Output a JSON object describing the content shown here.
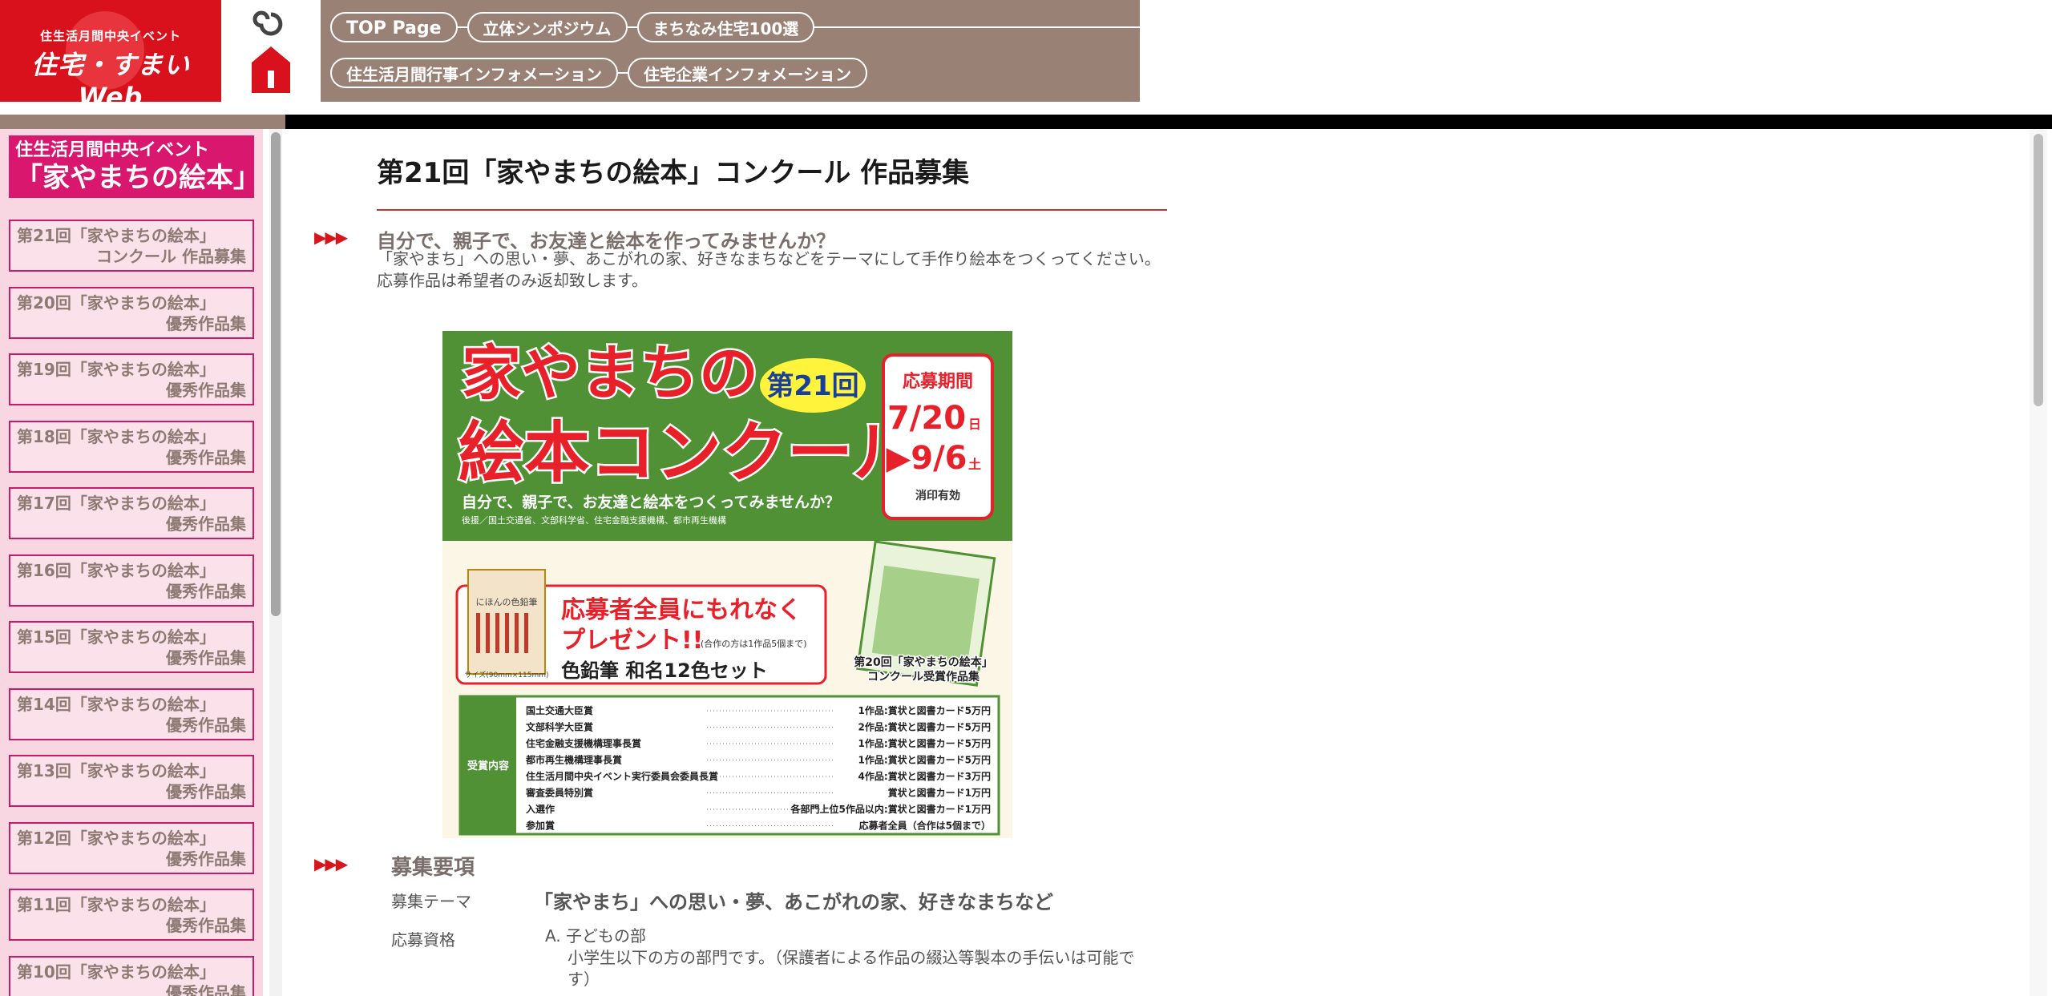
{
  "logo": {
    "sub": "住生活月間中央イベント",
    "main": "住宅・すまいWeb"
  },
  "nav": {
    "row1": [
      "TOP Page",
      "立体シンポジウム",
      "まちなみ住宅100選"
    ],
    "row2": [
      "住生活月間行事インフォメーション",
      "住宅企業インフォメーション"
    ]
  },
  "colors": {
    "brand_red": "#d8111c",
    "nav_brown": "#9a8175",
    "sidebar_pink": "#f8d6e2",
    "accent_magenta": "#d9176f"
  },
  "sidebar": {
    "header_small": "住生活月間中央イベント",
    "header_big": "「家やまちの絵本」",
    "items": [
      {
        "line1": "第21回「家やまちの絵本」",
        "line2": "コンクール 作品募集"
      },
      {
        "line1": "第20回「家やまちの絵本」",
        "line2": "優秀作品集"
      },
      {
        "line1": "第19回「家やまちの絵本」",
        "line2": "優秀作品集"
      },
      {
        "line1": "第18回「家やまちの絵本」",
        "line2": "優秀作品集"
      },
      {
        "line1": "第17回「家やまちの絵本」",
        "line2": "優秀作品集"
      },
      {
        "line1": "第16回「家やまちの絵本」",
        "line2": "優秀作品集"
      },
      {
        "line1": "第15回「家やまちの絵本」",
        "line2": "優秀作品集"
      },
      {
        "line1": "第14回「家やまちの絵本」",
        "line2": "優秀作品集"
      },
      {
        "line1": "第13回「家やまちの絵本」",
        "line2": "優秀作品集"
      },
      {
        "line1": "第12回「家やまちの絵本」",
        "line2": "優秀作品集"
      },
      {
        "line1": "第11回「家やまちの絵本」",
        "line2": "優秀作品集"
      },
      {
        "line1": "第10回「家やまちの絵本」",
        "line2": "優秀作品集"
      }
    ]
  },
  "main": {
    "title": "第21回「家やまちの絵本」コンクール 作品募集",
    "arrows": "▶▶▶",
    "lead_heading": "自分で、親子で、お友達と絵本を作ってみませんか？",
    "lead_line1": "「家やまち」への思い・夢、あこがれの家、好きなまちなどをテーマにして手作り絵本をつくってください。",
    "lead_line2": "応募作品は希望者のみ返却致します。",
    "section_heading": "募集要項",
    "theme_label": "募集テーマ",
    "theme_value": "「家やまち」への思い・夢、あこがれの家、好きなまちなど",
    "eligibility_label": "応募資格",
    "eligibility_a": "A. 子どもの部",
    "eligibility_a_desc": "小学生以下の方の部門です。（保護者による作品の綴込等製本の手伝いは可能です）"
  },
  "poster": {
    "title_line1": "家やまちの",
    "title_line2": "絵本コンクール",
    "edition": "第21回",
    "period_label": "応募期間",
    "period_start": "7/20",
    "period_start_day": "日",
    "period_end": "▶9/6",
    "period_end_day": "土",
    "period_note": "消印有効",
    "tagline": "自分で、親子で、お友達と絵本をつくってみませんか？",
    "sponsors": "後援／国土交通省、文部科学省、住宅金融支援機構、都市再生機構",
    "gift_line1": "応募者全員にもれなく",
    "gift_line2": "プレゼント!!",
    "gift_note": "(合作の方は1作品5個まで)",
    "gift_item": "色鉛筆 和名12色セット",
    "pencil_box_label": "にほんの色鉛筆",
    "size_note": "サイズ(90mm×115mm)",
    "book_caption_1": "第20回「家やまちの絵本」",
    "book_caption_2": "コンクール受賞作品集",
    "awards_label": "受賞内容",
    "awards": [
      {
        "name": "国土交通大臣賞",
        "prize": "1作品:賞状と図書カード5万円"
      },
      {
        "name": "文部科学大臣賞",
        "prize": "2作品:賞状と図書カード5万円"
      },
      {
        "name": "住宅金融支援機構理事長賞",
        "prize": "1作品:賞状と図書カード5万円"
      },
      {
        "name": "都市再生機構理事長賞",
        "prize": "1作品:賞状と図書カード5万円"
      },
      {
        "name": "住生活月間中央イベント実行委員会委員長賞",
        "prize": "4作品:賞状と図書カード3万円"
      },
      {
        "name": "審査委員特別賞",
        "prize": "賞状と図書カード1万円"
      },
      {
        "name": "入選作",
        "prize": "各部門上位5作品以内:賞状と図書カード1万円"
      },
      {
        "name": "参加賞",
        "prize": "応募者全員（合作は5個まで）"
      }
    ]
  }
}
